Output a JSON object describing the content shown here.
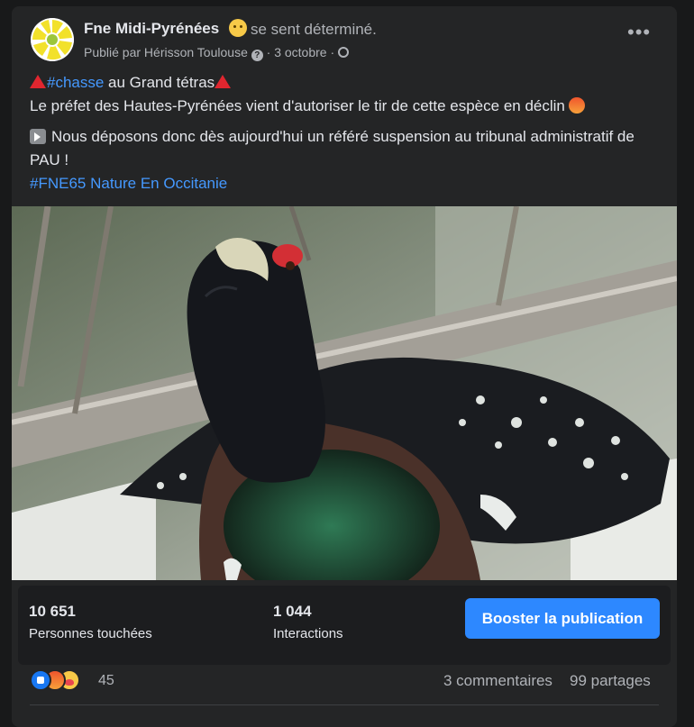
{
  "post": {
    "page_name": "Fne Midi-Pyrénées",
    "feeling": "se sent déterminé.",
    "published_by": "Publié par Hérisson Toulouse",
    "help_glyph": "?",
    "separator": " · ",
    "date": "3 octobre",
    "audience_icon": "globe-icon",
    "more_glyph": "•••",
    "body": {
      "line1_hashtag": "#chasse",
      "line1_rest": " au Grand tétras",
      "line2": "Le préfet des Hautes-Pyrénées vient d'autoriser le tir de cette espèce en déclin",
      "paragraph2": "Nous déposons donc dès aujourd'hui un référé suspension au tribunal administratif de PAU !",
      "hashtags": "#FNE65 Nature En Occitanie"
    }
  },
  "stats": {
    "reach_value": "10 651",
    "reach_label": "Personnes touchées",
    "engagement_value": "1 044",
    "engagement_label": "Interactions",
    "boost_label": "Booster la publication"
  },
  "footer": {
    "reactions_count": "45",
    "reaction_icons": [
      "like-icon",
      "angry-icon",
      "care-icon"
    ],
    "comments": "3 commentaires",
    "shares": "99 partages"
  },
  "colors": {
    "background": "#18191a",
    "card": "#242526",
    "link": "#4599ff",
    "boost_button": "#2d88ff",
    "triangle": "#e0262f"
  }
}
